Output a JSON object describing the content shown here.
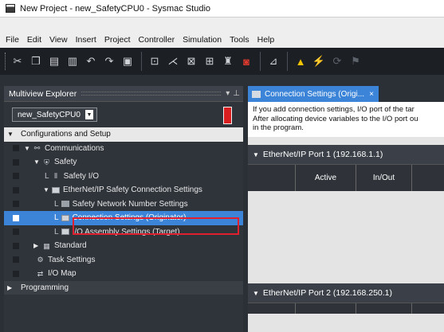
{
  "window": {
    "title": "New Project - new_SafetyCPU0 - Sysmac Studio"
  },
  "menu": [
    "File",
    "Edit",
    "View",
    "Insert",
    "Project",
    "Controller",
    "Simulation",
    "Tools",
    "Help"
  ],
  "explorer": {
    "title": "Multiview Explorer",
    "pin_icon": "pin-icon",
    "device": "new_SafetyCPU0",
    "tree": [
      {
        "label": "Configurations and Setup",
        "kind": "section"
      },
      {
        "label": "Communications",
        "icon": "network-icon"
      },
      {
        "label": "Safety",
        "icon": "safety-icon"
      },
      {
        "label": "Safety I/O",
        "icon": "io-icon"
      },
      {
        "label": "EtherNet/IP Safety Connection Settings",
        "icon": "ethernet-icon"
      },
      {
        "label": "Safety Network Number Settings",
        "icon": "network-number-icon"
      },
      {
        "label": "Connection Settings (Originator)",
        "icon": "connection-icon"
      },
      {
        "label": "I/O Assembly Settings (Target)",
        "icon": "assembly-icon"
      },
      {
        "label": "Standard",
        "icon": "standard-icon"
      },
      {
        "label": "Task Settings",
        "icon": "task-icon"
      },
      {
        "label": "I/O Map",
        "icon": "io-map-icon"
      },
      {
        "label": "Programming",
        "kind": "section-dark"
      }
    ]
  },
  "editor": {
    "tab": {
      "label": "Connection Settings (Origi...",
      "close": "×"
    },
    "info_lines": [
      "If you add connection settings, I/O port of the tar",
      "After allocating device variables to the I/O port ou",
      "in the program."
    ],
    "port1": {
      "label": "EtherNet/IP Port 1 (192.168.1.1)",
      "columns": [
        "",
        "Active",
        "In/Out"
      ]
    },
    "port2": {
      "label": "EtherNet/IP Port 2 (192.168.250.1)"
    }
  }
}
